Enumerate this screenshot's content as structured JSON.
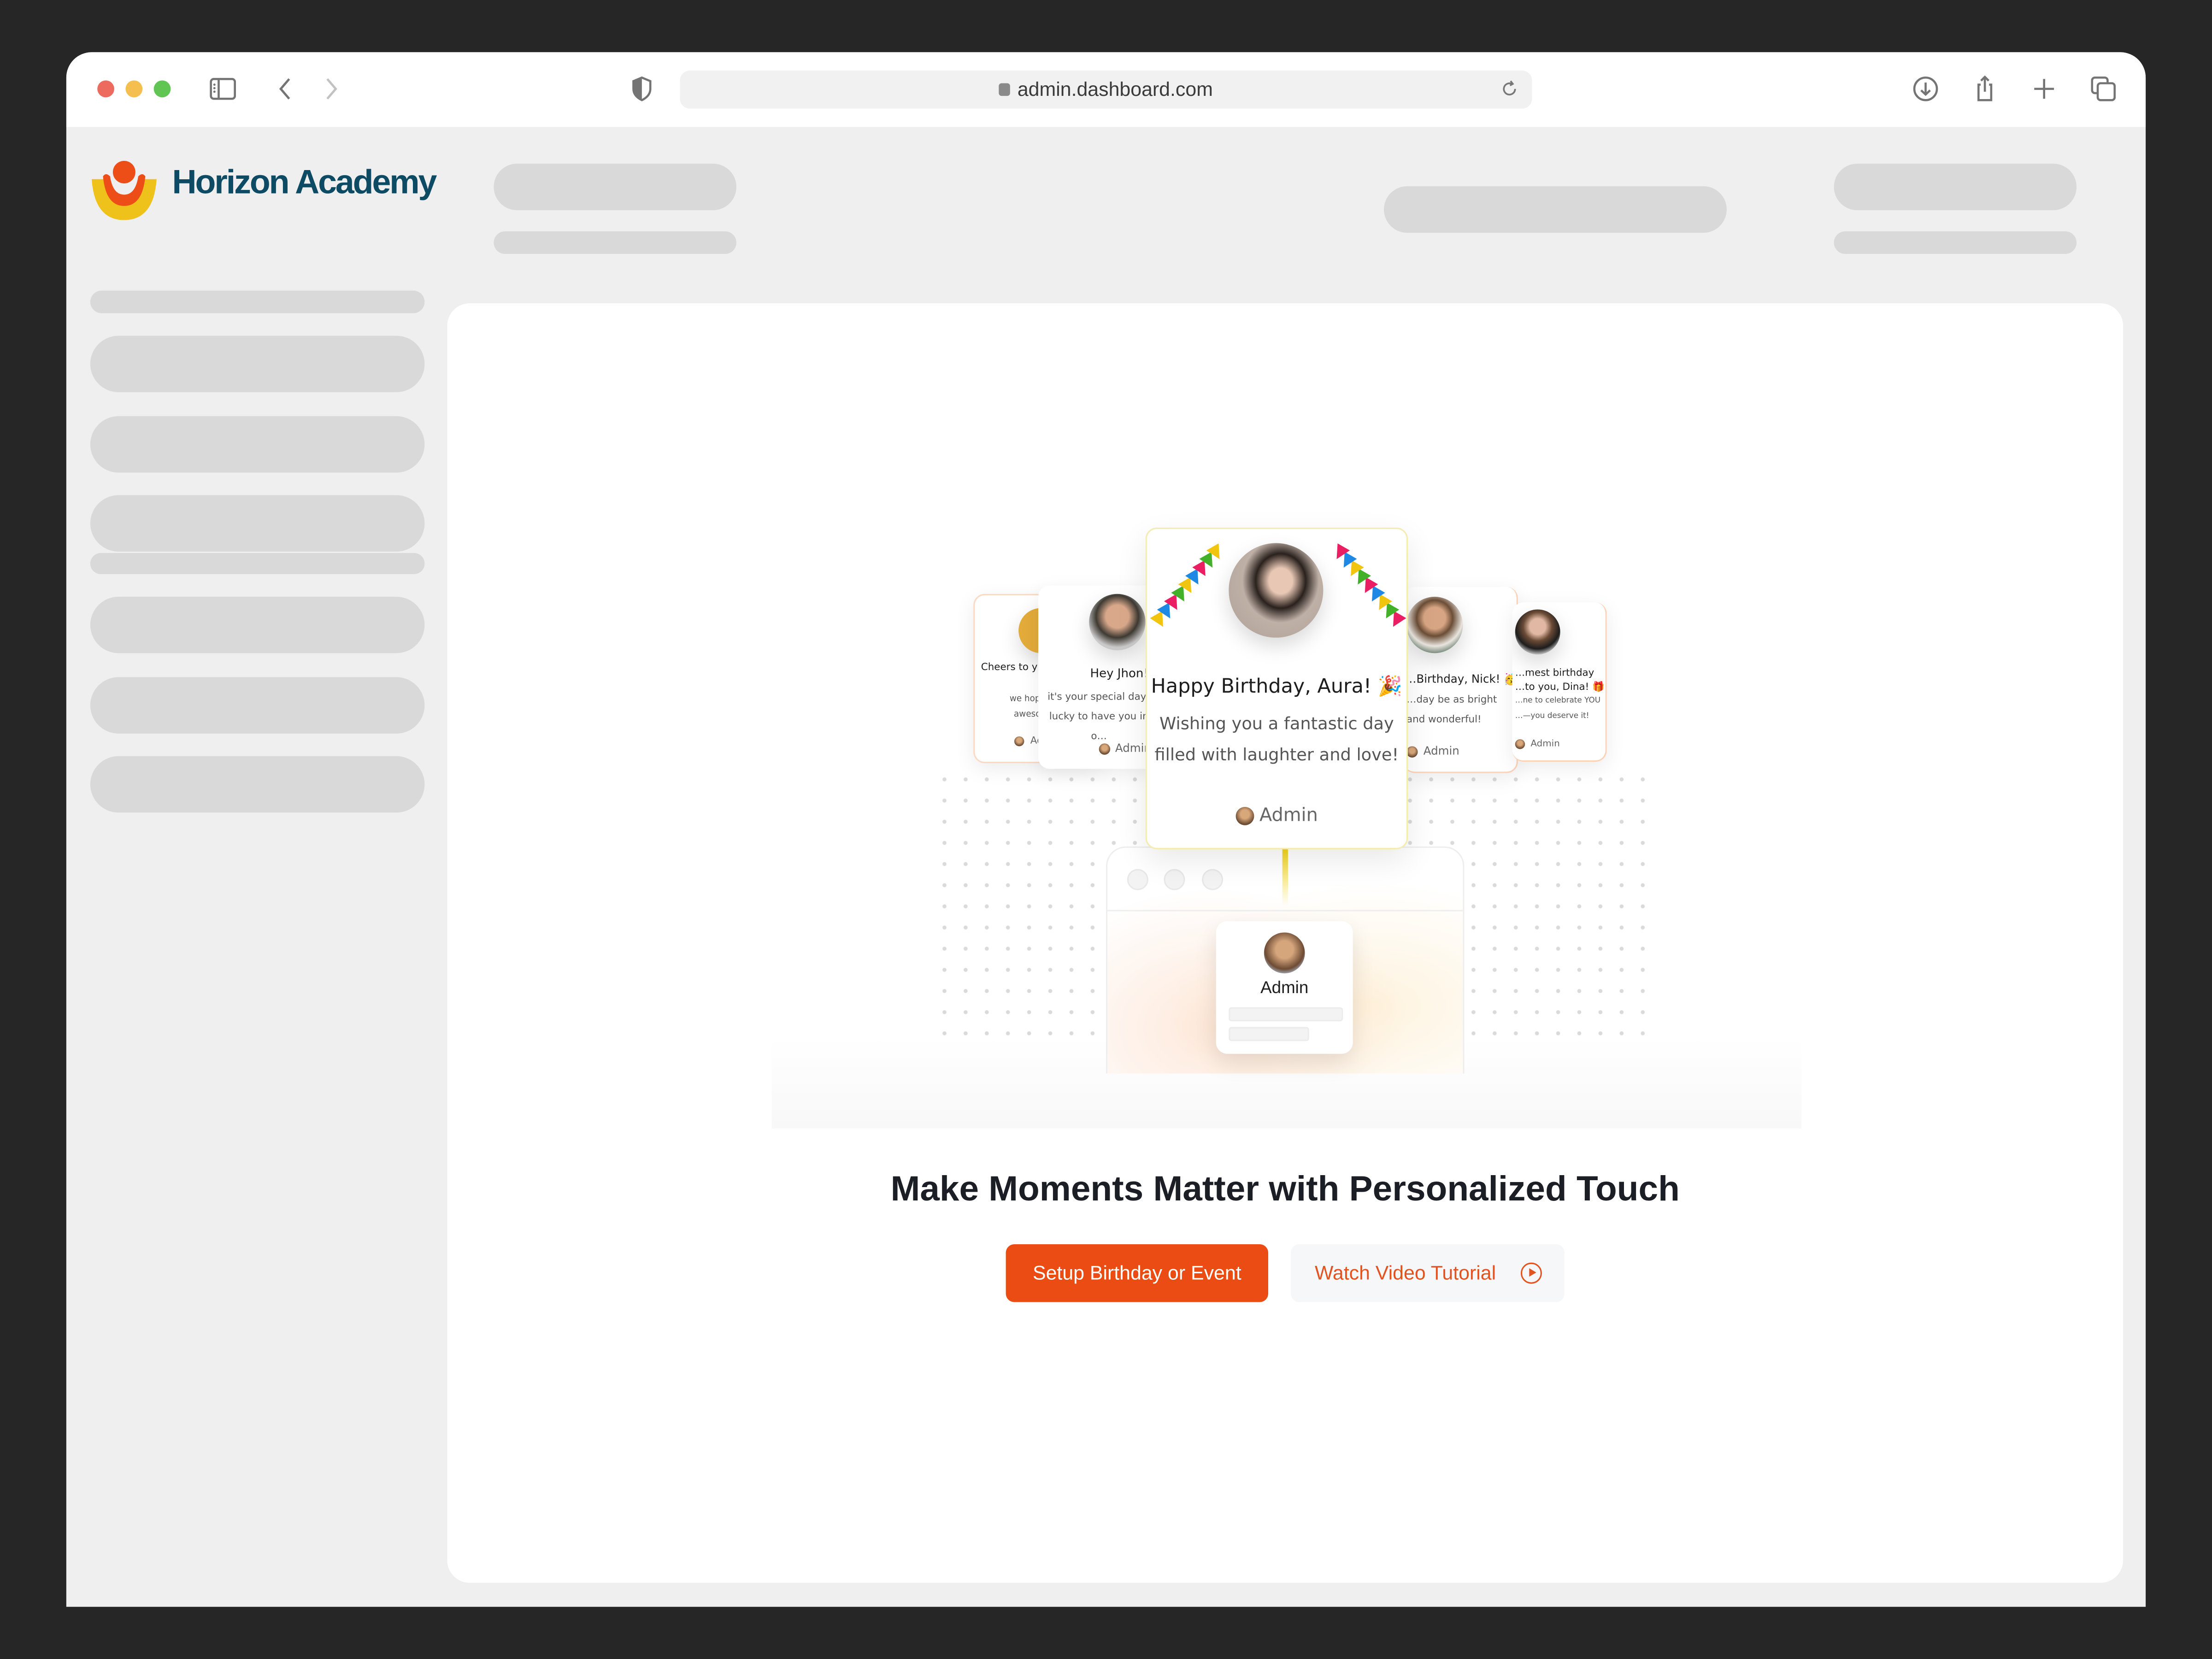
{
  "browser": {
    "url": "admin.dashboard.com",
    "traffic_lights": {
      "close": "#ec6a5e",
      "minimize": "#f4bf4f",
      "maximize": "#61c554"
    },
    "icons": {
      "sidebar": "sidebar-toggle-icon",
      "back": "chevron-left-icon",
      "forward": "chevron-right-icon",
      "privacy": "shield-icon",
      "lock": "lock-icon",
      "reload": "reload-icon",
      "download": "download-icon",
      "share": "share-icon",
      "new_tab": "plus-icon",
      "tabs": "tabs-overview-icon"
    }
  },
  "app": {
    "brand": "Horizon Academy",
    "brand_color": "#0d4a63",
    "accent_color": "#ea4c13"
  },
  "illustration": {
    "cards": [
      {
        "title": "Cheers to y… Birthday,",
        "message": "we hope yo… awesome…",
        "author": "Admin"
      },
      {
        "title": "Hey Jhon!",
        "message": "it's your special day! lucky to have you in o…",
        "author": "Admin"
      },
      {
        "title": "Happy Birthday, Aura! 🎉",
        "message_line1": "Wishing you a fantastic day",
        "message_line2": "filled with laughter and love!",
        "author": "Admin"
      },
      {
        "title": "…Birthday, Nick! 🥳",
        "message": "…day be as bright and wonderful!",
        "author": "Admin"
      },
      {
        "title": "…mest birthday …to you, Dina! 🎁",
        "message": "…ne to celebrate YOU …—you deserve it!",
        "author": "Admin"
      }
    ],
    "admin_card_label": "Admin"
  },
  "main": {
    "heading": "Make Moments Matter with Personalized Touch",
    "primary_button": "Setup Birthday or Event",
    "secondary_button": "Watch Video Tutorial"
  }
}
